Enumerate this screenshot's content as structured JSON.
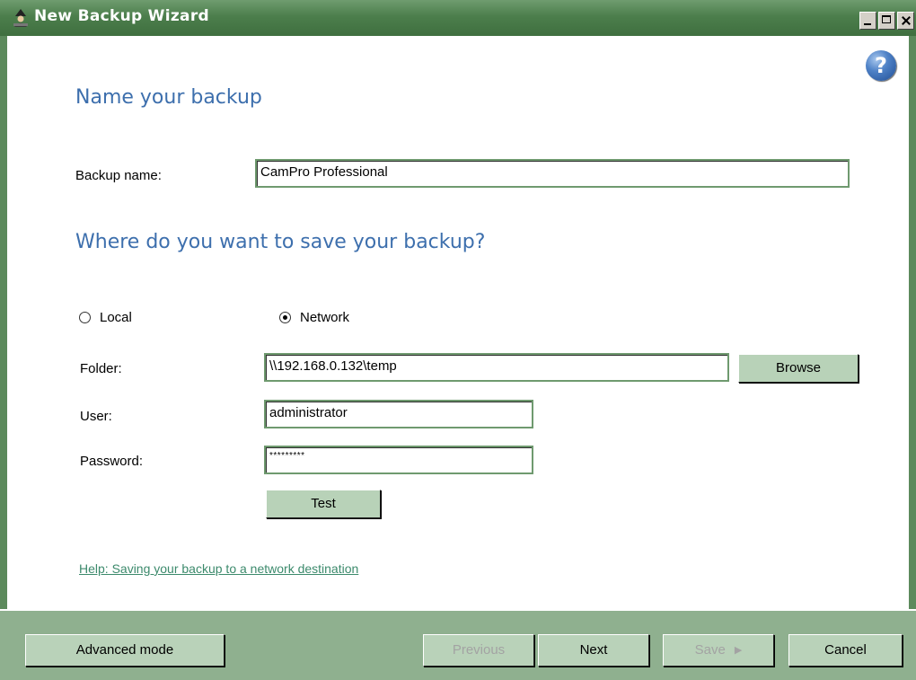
{
  "window": {
    "title": "New Backup Wizard",
    "icon": "wizard-icon"
  },
  "help": {
    "icon": "question-icon",
    "glyph": "?"
  },
  "sections": {
    "name": {
      "heading": "Name your backup",
      "label": "Backup name:",
      "value": "CamPro Professional"
    },
    "destination": {
      "heading": "Where do you want to save your backup?",
      "options": [
        {
          "label": "Local",
          "selected": false
        },
        {
          "label": "Network",
          "selected": true
        }
      ],
      "folder_label": "Folder:",
      "folder_value": "\\\\192.168.0.132\\temp",
      "browse_label": "Browse",
      "user_label": "User:",
      "user_value": "administrator",
      "password_label": "Password:",
      "password_value": "*********",
      "test_label": "Test",
      "help_link": "Help: Saving your backup to a network destination"
    }
  },
  "footer": {
    "advanced_label": "Advanced mode",
    "previous_label": "Previous",
    "next_label": "Next",
    "save_label": "Save",
    "save_arrow": "▶",
    "cancel_label": "Cancel"
  },
  "colors": {
    "title_bar": "#4c7e4c",
    "heading": "#3d6fad",
    "link": "#3c8a6c",
    "footer": "#8fb08f",
    "button": "#b8d2b8"
  }
}
